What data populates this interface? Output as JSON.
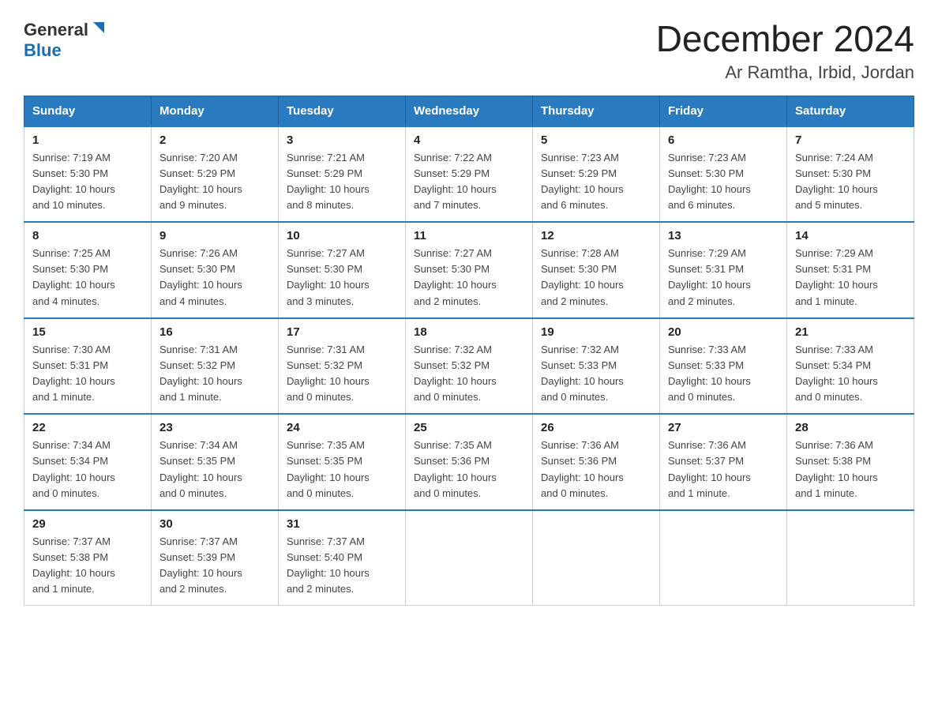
{
  "logo": {
    "general": "General",
    "blue": "Blue",
    "triangle": "▶"
  },
  "title": "December 2024",
  "subtitle": "Ar Ramtha, Irbid, Jordan",
  "headers": [
    "Sunday",
    "Monday",
    "Tuesday",
    "Wednesday",
    "Thursday",
    "Friday",
    "Saturday"
  ],
  "weeks": [
    [
      {
        "day": "1",
        "detail": "Sunrise: 7:19 AM\nSunset: 5:30 PM\nDaylight: 10 hours\nand 10 minutes."
      },
      {
        "day": "2",
        "detail": "Sunrise: 7:20 AM\nSunset: 5:29 PM\nDaylight: 10 hours\nand 9 minutes."
      },
      {
        "day": "3",
        "detail": "Sunrise: 7:21 AM\nSunset: 5:29 PM\nDaylight: 10 hours\nand 8 minutes."
      },
      {
        "day": "4",
        "detail": "Sunrise: 7:22 AM\nSunset: 5:29 PM\nDaylight: 10 hours\nand 7 minutes."
      },
      {
        "day": "5",
        "detail": "Sunrise: 7:23 AM\nSunset: 5:29 PM\nDaylight: 10 hours\nand 6 minutes."
      },
      {
        "day": "6",
        "detail": "Sunrise: 7:23 AM\nSunset: 5:30 PM\nDaylight: 10 hours\nand 6 minutes."
      },
      {
        "day": "7",
        "detail": "Sunrise: 7:24 AM\nSunset: 5:30 PM\nDaylight: 10 hours\nand 5 minutes."
      }
    ],
    [
      {
        "day": "8",
        "detail": "Sunrise: 7:25 AM\nSunset: 5:30 PM\nDaylight: 10 hours\nand 4 minutes."
      },
      {
        "day": "9",
        "detail": "Sunrise: 7:26 AM\nSunset: 5:30 PM\nDaylight: 10 hours\nand 4 minutes."
      },
      {
        "day": "10",
        "detail": "Sunrise: 7:27 AM\nSunset: 5:30 PM\nDaylight: 10 hours\nand 3 minutes."
      },
      {
        "day": "11",
        "detail": "Sunrise: 7:27 AM\nSunset: 5:30 PM\nDaylight: 10 hours\nand 2 minutes."
      },
      {
        "day": "12",
        "detail": "Sunrise: 7:28 AM\nSunset: 5:30 PM\nDaylight: 10 hours\nand 2 minutes."
      },
      {
        "day": "13",
        "detail": "Sunrise: 7:29 AM\nSunset: 5:31 PM\nDaylight: 10 hours\nand 2 minutes."
      },
      {
        "day": "14",
        "detail": "Sunrise: 7:29 AM\nSunset: 5:31 PM\nDaylight: 10 hours\nand 1 minute."
      }
    ],
    [
      {
        "day": "15",
        "detail": "Sunrise: 7:30 AM\nSunset: 5:31 PM\nDaylight: 10 hours\nand 1 minute."
      },
      {
        "day": "16",
        "detail": "Sunrise: 7:31 AM\nSunset: 5:32 PM\nDaylight: 10 hours\nand 1 minute."
      },
      {
        "day": "17",
        "detail": "Sunrise: 7:31 AM\nSunset: 5:32 PM\nDaylight: 10 hours\nand 0 minutes."
      },
      {
        "day": "18",
        "detail": "Sunrise: 7:32 AM\nSunset: 5:32 PM\nDaylight: 10 hours\nand 0 minutes."
      },
      {
        "day": "19",
        "detail": "Sunrise: 7:32 AM\nSunset: 5:33 PM\nDaylight: 10 hours\nand 0 minutes."
      },
      {
        "day": "20",
        "detail": "Sunrise: 7:33 AM\nSunset: 5:33 PM\nDaylight: 10 hours\nand 0 minutes."
      },
      {
        "day": "21",
        "detail": "Sunrise: 7:33 AM\nSunset: 5:34 PM\nDaylight: 10 hours\nand 0 minutes."
      }
    ],
    [
      {
        "day": "22",
        "detail": "Sunrise: 7:34 AM\nSunset: 5:34 PM\nDaylight: 10 hours\nand 0 minutes."
      },
      {
        "day": "23",
        "detail": "Sunrise: 7:34 AM\nSunset: 5:35 PM\nDaylight: 10 hours\nand 0 minutes."
      },
      {
        "day": "24",
        "detail": "Sunrise: 7:35 AM\nSunset: 5:35 PM\nDaylight: 10 hours\nand 0 minutes."
      },
      {
        "day": "25",
        "detail": "Sunrise: 7:35 AM\nSunset: 5:36 PM\nDaylight: 10 hours\nand 0 minutes."
      },
      {
        "day": "26",
        "detail": "Sunrise: 7:36 AM\nSunset: 5:36 PM\nDaylight: 10 hours\nand 0 minutes."
      },
      {
        "day": "27",
        "detail": "Sunrise: 7:36 AM\nSunset: 5:37 PM\nDaylight: 10 hours\nand 1 minute."
      },
      {
        "day": "28",
        "detail": "Sunrise: 7:36 AM\nSunset: 5:38 PM\nDaylight: 10 hours\nand 1 minute."
      }
    ],
    [
      {
        "day": "29",
        "detail": "Sunrise: 7:37 AM\nSunset: 5:38 PM\nDaylight: 10 hours\nand 1 minute."
      },
      {
        "day": "30",
        "detail": "Sunrise: 7:37 AM\nSunset: 5:39 PM\nDaylight: 10 hours\nand 2 minutes."
      },
      {
        "day": "31",
        "detail": "Sunrise: 7:37 AM\nSunset: 5:40 PM\nDaylight: 10 hours\nand 2 minutes."
      },
      null,
      null,
      null,
      null
    ]
  ]
}
